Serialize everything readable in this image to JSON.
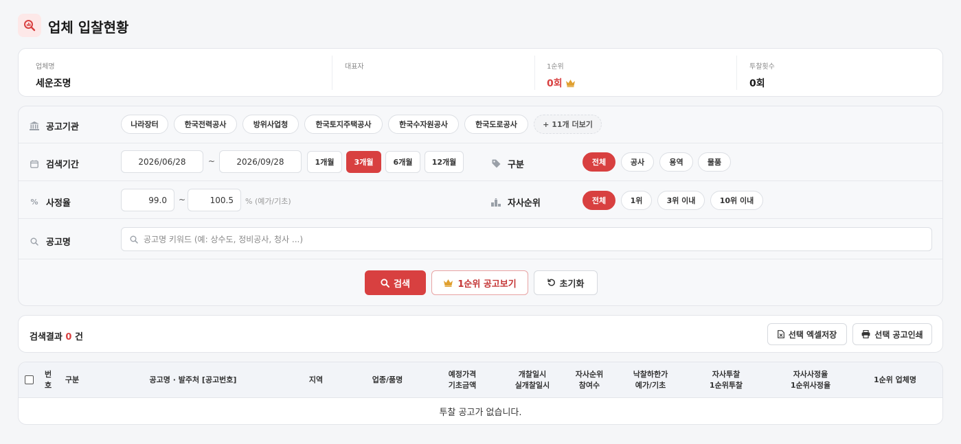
{
  "page": {
    "title": "업체 입찰현황",
    "title_icon": "search-chart-icon"
  },
  "info": {
    "company_label": "업체명",
    "company_value": "세운조명",
    "ceo_label": "대표자",
    "ceo_value": "",
    "first_rank_label": "1순위",
    "first_rank_value": "0회",
    "bid_count_label": "투찰횟수",
    "bid_count_value": "0회"
  },
  "filters": {
    "agency": {
      "label": "공고기관",
      "chips": [
        "나라장터",
        "한국전력공사",
        "방위사업청",
        "한국토지주택공사",
        "한국수자원공사",
        "한국도로공사"
      ],
      "more": "+ 11개 더보기"
    },
    "period": {
      "label": "검색기간",
      "start": "2026/06/28",
      "end": "2026/09/28",
      "separator": "~",
      "presets": [
        "1개월",
        "3개월",
        "6개월",
        "12개월"
      ],
      "active_preset": "3개월"
    },
    "type": {
      "label": "구분",
      "options": [
        "전체",
        "공사",
        "용역",
        "물품"
      ],
      "active": "전체"
    },
    "rate": {
      "label": "사정율",
      "min": "99.0",
      "max": "100.5",
      "separator": "~",
      "unit_hint": "% (예가/기초)"
    },
    "rank": {
      "label": "자사순위",
      "options": [
        "전체",
        "1위",
        "3위 이내",
        "10위 이내"
      ],
      "active": "전체"
    },
    "keyword": {
      "label": "공고명",
      "placeholder": "공고명 키워드 (예: 상수도, 정비공사, 청사 ...)",
      "value": ""
    }
  },
  "actions": {
    "search": "검색",
    "first_rank": "1순위 공고보기",
    "reset": "초기화"
  },
  "results": {
    "prefix": "검색결과",
    "count": "0",
    "suffix": "건",
    "excel_label": "선택 엑셀저장",
    "print_label": "선택 공고인쇄"
  },
  "table": {
    "columns": [
      [
        "번",
        "호"
      ],
      [
        "구분"
      ],
      [
        "공고명 · 발주처 [공고번호]"
      ],
      [
        "지역"
      ],
      [
        "업종/품명"
      ],
      [
        "예정가격",
        "기초금액"
      ],
      [
        "개찰일시",
        "실개찰일시"
      ],
      [
        "자사순위",
        "참여수"
      ],
      [
        "낙찰하한가",
        "예가/기초"
      ],
      [
        "자사투찰",
        "1순위투찰"
      ],
      [
        "자사사정율",
        "1순위사정율"
      ],
      [
        "1순위 업체명"
      ]
    ],
    "empty_message": "투찰 공고가 없습니다."
  },
  "colors": {
    "accent": "#d84040",
    "crown": "#e0a030",
    "background": "#f5f6f8"
  }
}
